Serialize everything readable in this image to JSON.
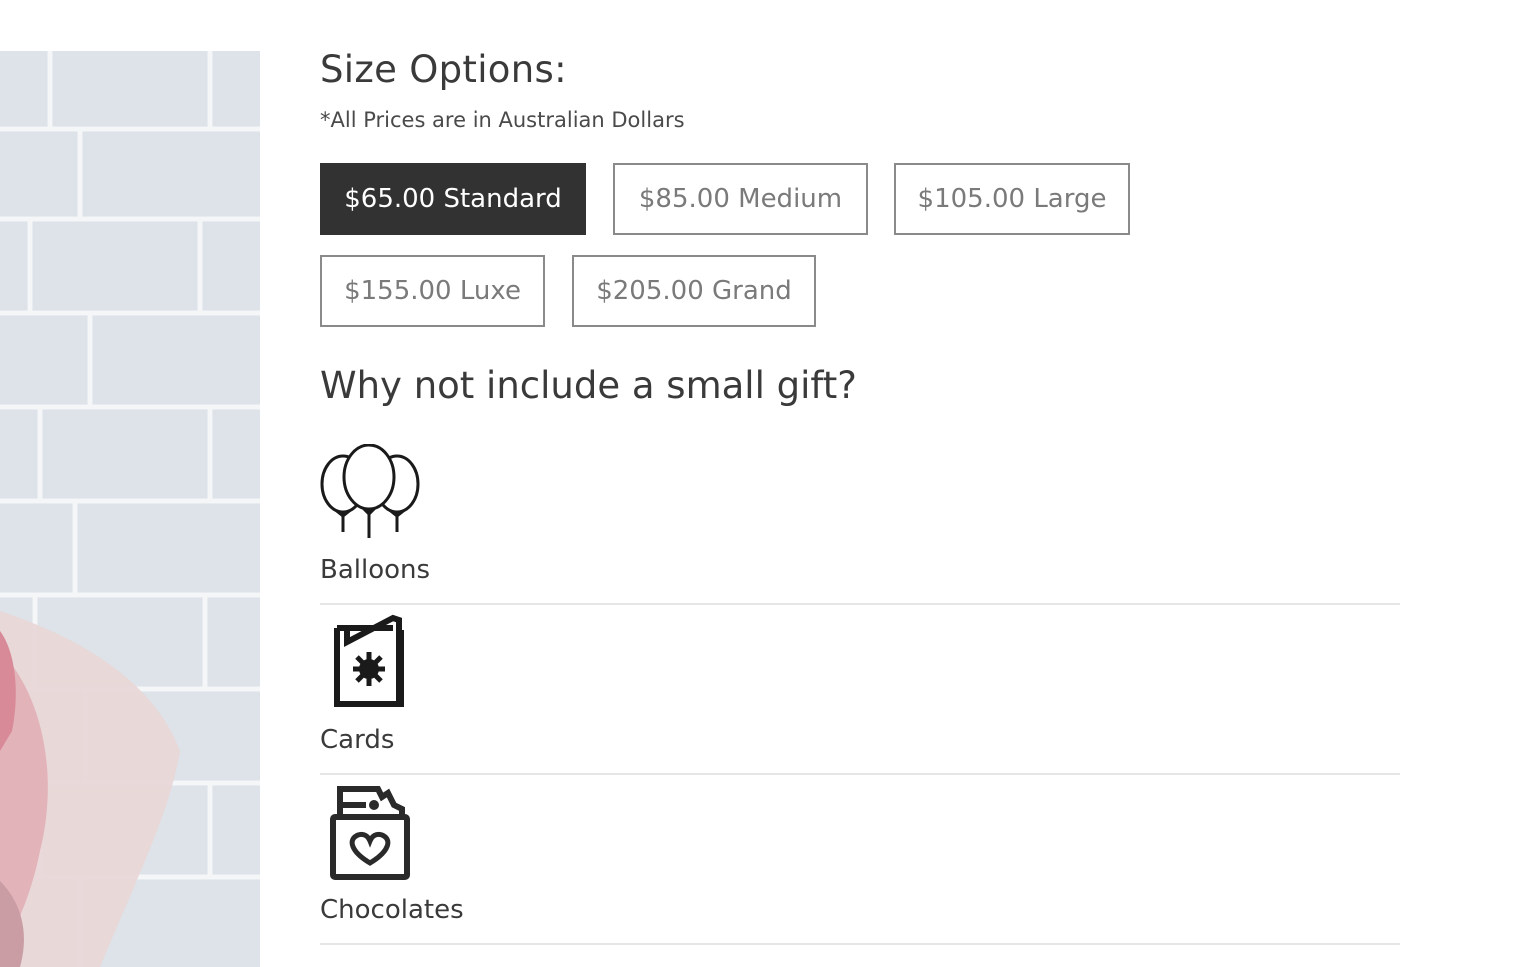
{
  "size_section": {
    "title": "Size Options:",
    "note": "*All Prices are in Australian Dollars",
    "options": [
      {
        "label": "$65.00 Standard",
        "selected": true
      },
      {
        "label": "$85.00 Medium",
        "selected": false
      },
      {
        "label": "$105.00 Large",
        "selected": false
      },
      {
        "label": "$155.00 Luxe",
        "selected": false
      },
      {
        "label": "$205.00 Grand",
        "selected": false
      }
    ]
  },
  "gift_section": {
    "title": "Why not include a small gift?",
    "items": [
      {
        "label": "Balloons",
        "icon": "balloons-icon"
      },
      {
        "label": "Cards",
        "icon": "card-icon"
      },
      {
        "label": "Chocolates",
        "icon": "chocolate-icon"
      }
    ]
  },
  "colors": {
    "selected_bg": "#323232",
    "button_border": "#8a8a8a",
    "divider": "#e6e6e6"
  }
}
